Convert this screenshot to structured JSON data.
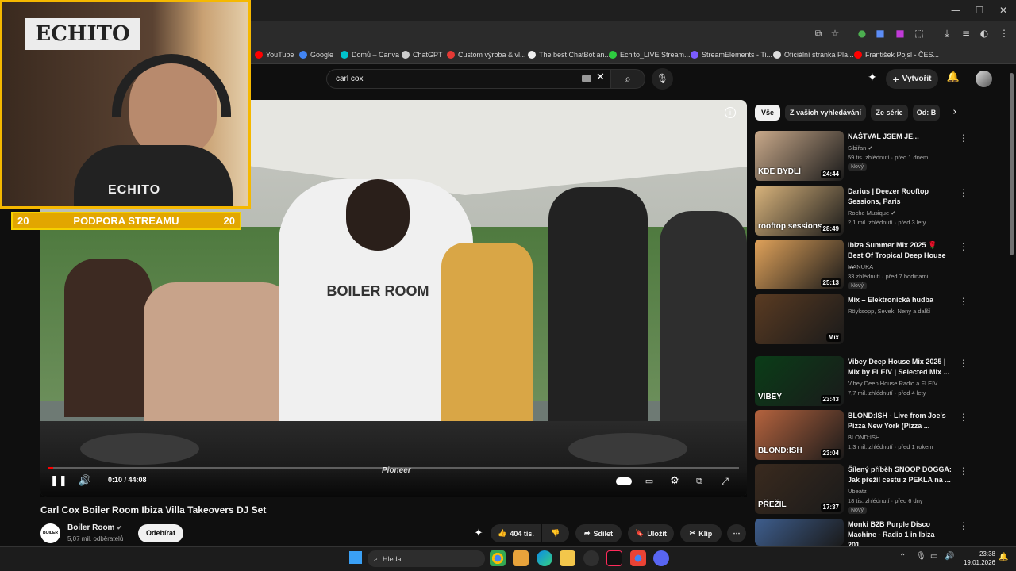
{
  "browser": {
    "window_controls": {
      "minimize": "—",
      "maximize": "☐",
      "close": "✕"
    },
    "bookmarks": [
      {
        "label": "YouTube",
        "color": "#ff0000"
      },
      {
        "label": "Google",
        "color": "#4285f4"
      },
      {
        "label": "Domů – Canva",
        "color": "#00c4cc"
      },
      {
        "label": "ChatGPT",
        "color": "#cccccc"
      },
      {
        "label": "Custom výroba & vl...",
        "color": "#e53935"
      },
      {
        "label": "The best ChatBot an...",
        "color": "#eeeeee"
      },
      {
        "label": "Echito_LIVE Stream...",
        "color": "#2ecc40"
      },
      {
        "label": "StreamElements - Ti...",
        "color": "#7b5cff"
      },
      {
        "label": "Oficiální stránka Pla...",
        "color": "#dddddd"
      },
      {
        "label": "František Pojsl - ČES...",
        "color": "#ff0000"
      }
    ]
  },
  "header": {
    "search_value": "carl cox",
    "create_label": "Vytvořit"
  },
  "overlay": {
    "banner_left": "20",
    "banner_text": "PODPORA STREAMU",
    "banner_right": "20",
    "webcam_sign": "ECHITO",
    "shirt_text": "ECHITO"
  },
  "player": {
    "time": "0:10 / 44:08",
    "progress": 0.004,
    "scene_text": "BOILER ROOM",
    "deck_brand": "Pioneer"
  },
  "video": {
    "title": "Carl Cox Boiler Room Ibiza Villa Takeovers DJ Set",
    "channel": "Boiler Room",
    "channel_avatar_text": "BOILER ROOM",
    "subscribers": "5,07 mil. odběratelů",
    "subscribe_label": "Odebírat",
    "likes": "404 tis.",
    "share_label": "Sdílet",
    "save_label": "Uložit",
    "clip_label": "Klip"
  },
  "sidebar": {
    "chips": [
      "Vše",
      "Z vašich vyhledávání",
      "Ze série",
      "Od: B"
    ],
    "recommendations": [
      {
        "title": "NAŠTVAL JSEM JE...",
        "channel": "Sibiřan",
        "verified": true,
        "meta": "59 tis. zhlédnutí · před 1 dnem",
        "duration": "24:44",
        "badge": "Nový",
        "thumb_text": "KDE BYDLÍ",
        "thumb_color": "#c9a98a"
      },
      {
        "title": "Darius | Deezer Rooftop Sessions, Paris",
        "channel": "Roche Musique",
        "verified": true,
        "meta": "2,1 mil. zhlédnutí · před 3 lety",
        "duration": "28:49",
        "badge": "",
        "thumb_text": "rooftop sessions",
        "thumb_color": "#d9b47c"
      },
      {
        "title": "Ibiza Summer Mix 2025 🌹 Best Of Tropical Deep House ...",
        "channel": "MANUKA",
        "verified": false,
        "meta": "33 zhlédnutí · před 7 hodinami",
        "duration": "25:13",
        "badge": "Nový",
        "thumb_text": "",
        "thumb_color": "#e0a25a"
      },
      {
        "title": "Mix – Elektronická hudba",
        "channel": "Röyksopp, Sevek, Neny a další",
        "verified": false,
        "meta": "",
        "duration": "Mix",
        "badge": "",
        "thumb_text": "",
        "thumb_color": "#5a3b22"
      },
      {
        "title": "Vibey Deep House Mix 2025 | Mix by FLEIV | Selected Mix ...",
        "channel": "Vibey Deep House Radio a FLEIV",
        "verified": false,
        "meta": "7,7 mil. zhlédnutí · před 4 lety",
        "duration": "23:43",
        "badge": "",
        "thumb_text": "VIBEY",
        "thumb_color": "#0a3d18"
      },
      {
        "title": "BLOND:ISH - Live from Joe's Pizza New York (Pizza ...",
        "channel": "BLOND:ISH",
        "verified": false,
        "meta": "1,3 mil. zhlédnutí · před 1 rokem",
        "duration": "23:04",
        "badge": "",
        "thumb_text": "BLOND:ISH",
        "thumb_color": "#b5633e"
      },
      {
        "title": "Šílený příběh SNOOP DOGGA: Jak přežil cestu z PEKLA na ...",
        "channel": "Ubeatz",
        "verified": false,
        "meta": "18 tis. zhlédnutí · před 6 dny",
        "duration": "17:37",
        "badge": "Nový",
        "thumb_text": "PŘEŽIL",
        "thumb_color": "#3a2a1e"
      },
      {
        "title": "Monki B2B Purple Disco Machine - Radio 1 in Ibiza 201...",
        "channel": "",
        "verified": false,
        "meta": "",
        "duration": "",
        "badge": "",
        "thumb_text": "",
        "thumb_color": "#3e5e8e"
      }
    ]
  },
  "taskbar": {
    "search_label": "Hledat",
    "time": "23:38",
    "date": "19.01.2026"
  }
}
